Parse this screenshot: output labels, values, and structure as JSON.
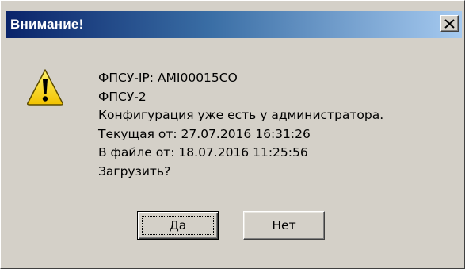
{
  "window": {
    "title": "Внимание!",
    "close_label": "×"
  },
  "icon": {
    "name": "warning-icon",
    "color": "#f7d417"
  },
  "message": {
    "lines": [
      "ФПСУ-IP: AMI00015CO",
      "ФПСУ-2",
      "Конфигурация уже есть у администратора.",
      "Текущая от: 27.07.2016 16:31:26",
      "В файле от: 18.07.2016 11:25:56",
      "Загрузить?"
    ]
  },
  "buttons": {
    "yes_label": "Да",
    "no_label": "Нет"
  },
  "colors": {
    "titlebar_start": "#0a246a",
    "titlebar_end": "#a6caf0",
    "dialog_bg": "#d4d0c8"
  }
}
